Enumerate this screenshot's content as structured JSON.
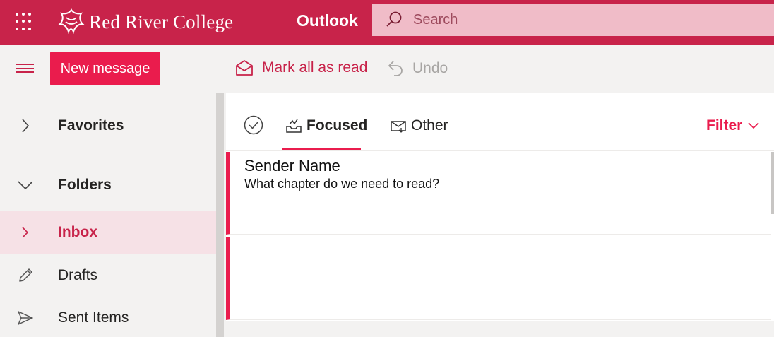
{
  "header": {
    "college_name": "Red River College",
    "app_name": "Outlook",
    "search_placeholder": "Search"
  },
  "toolbar": {
    "new_message_label": "New message",
    "mark_all_read_label": "Mark all as read",
    "undo_label": "Undo"
  },
  "sidebar": {
    "items": [
      {
        "label": "Favorites",
        "icon": "chevron-right-icon"
      },
      {
        "label": "Folders",
        "icon": "chevron-down-icon"
      },
      {
        "label": "Inbox",
        "icon": "chevron-right-icon"
      },
      {
        "label": "Drafts",
        "icon": "pencil-icon"
      },
      {
        "label": "Sent Items",
        "icon": "send-icon"
      }
    ]
  },
  "tabs": {
    "focused_label": "Focused",
    "other_label": "Other",
    "filter_label": "Filter"
  },
  "messages": [
    {
      "sender": "Sender Name",
      "preview": "What chapter do we need to read?"
    }
  ],
  "colors": {
    "brand": "#c8234a",
    "accent": "#ea1c4d"
  }
}
